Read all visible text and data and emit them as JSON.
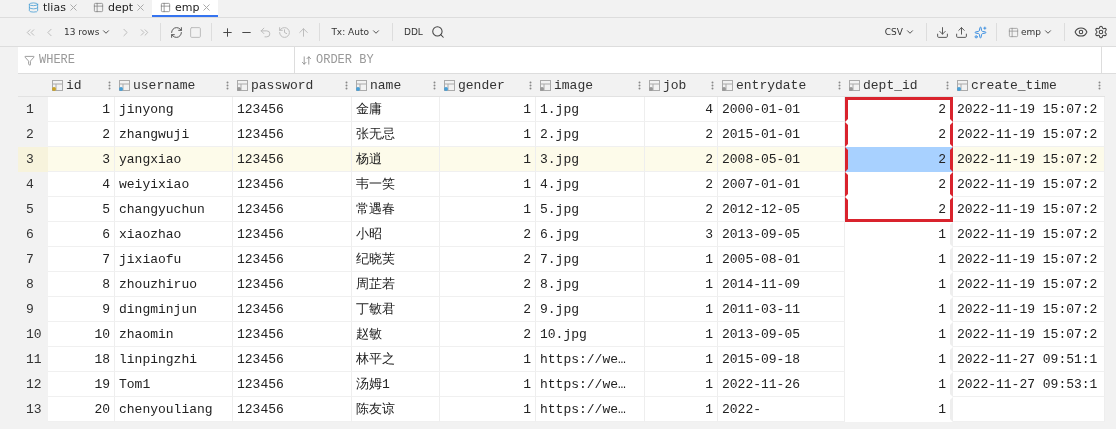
{
  "tabs": [
    {
      "label": "tlias",
      "kind": "schema",
      "selected": false
    },
    {
      "label": "dept",
      "kind": "table",
      "selected": false
    },
    {
      "label": "emp",
      "kind": "table",
      "selected": true
    }
  ],
  "toolbar": {
    "rows": "13 rows",
    "tx": "Tx: Auto",
    "ddl": "DDL",
    "export": "CSV",
    "schema": "emp"
  },
  "filter": {
    "where": "WHERE",
    "order": "ORDER BY"
  },
  "columns": [
    {
      "name": "id",
      "kind": "key"
    },
    {
      "name": "username",
      "kind": "index"
    },
    {
      "name": "password",
      "kind": "plain"
    },
    {
      "name": "name",
      "kind": "index"
    },
    {
      "name": "gender",
      "kind": "index"
    },
    {
      "name": "image",
      "kind": "plain"
    },
    {
      "name": "job",
      "kind": "plain"
    },
    {
      "name": "entrydate",
      "kind": "plain"
    },
    {
      "name": "dept_id",
      "kind": "plain"
    },
    {
      "name": "create_time",
      "kind": "index"
    }
  ],
  "rows": [
    {
      "number": "1",
      "current": false,
      "cells": [
        "1",
        "jinyong",
        "123456",
        "金庸",
        "1",
        "1.jpg",
        "4",
        "2000-01-01",
        {
          "text": "2",
          "selected": false,
          "framed": true
        },
        "2022-11-19 15:07:2"
      ]
    },
    {
      "number": "2",
      "current": false,
      "cells": [
        "2",
        "zhangwuji",
        "123456",
        "张无忌",
        "1",
        "2.jpg",
        "2",
        "2015-01-01",
        {
          "text": "2",
          "selected": false,
          "framed": true
        },
        "2022-11-19 15:07:2"
      ]
    },
    {
      "number": "3",
      "current": true,
      "cells": [
        "3",
        "yangxiao",
        "123456",
        "杨逍",
        "1",
        "3.jpg",
        "2",
        "2008-05-01",
        {
          "text": "2",
          "selected": true,
          "framed": true
        },
        "2022-11-19 15:07:2"
      ]
    },
    {
      "number": "4",
      "current": false,
      "cells": [
        "4",
        "weiyixiao",
        "123456",
        "韦一笑",
        "1",
        "4.jpg",
        "2",
        "2007-01-01",
        {
          "text": "2",
          "selected": false,
          "framed": true
        },
        "2022-11-19 15:07:2"
      ]
    },
    {
      "number": "5",
      "current": false,
      "cells": [
        "5",
        "changyuchun",
        "123456",
        "常遇春",
        "1",
        "5.jpg",
        "2",
        "2012-12-05",
        {
          "text": "2",
          "selected": false,
          "framed": true
        },
        "2022-11-19 15:07:2"
      ]
    },
    {
      "number": "6",
      "current": false,
      "cells": [
        "6",
        "xiaozhao",
        "123456",
        "小昭",
        "2",
        "6.jpg",
        "3",
        "2013-09-05",
        {
          "text": "1",
          "selected": false,
          "framed": false
        },
        "2022-11-19 15:07:2"
      ]
    },
    {
      "number": "7",
      "current": false,
      "cells": [
        "7",
        "jixiaofu",
        "123456",
        "纪晓芙",
        "2",
        "7.jpg",
        "1",
        "2005-08-01",
        {
          "text": "1",
          "selected": false,
          "framed": false
        },
        "2022-11-19 15:07:2"
      ]
    },
    {
      "number": "8",
      "current": false,
      "cells": [
        "8",
        "zhouzhiruo",
        "123456",
        "周芷若",
        "2",
        "8.jpg",
        "1",
        "2014-11-09",
        {
          "text": "1",
          "selected": false,
          "framed": false
        },
        "2022-11-19 15:07:2"
      ]
    },
    {
      "number": "9",
      "current": false,
      "cells": [
        "9",
        "dingminjun",
        "123456",
        "丁敏君",
        "2",
        "9.jpg",
        "1",
        "2011-03-11",
        {
          "text": "1",
          "selected": false,
          "framed": false
        },
        "2022-11-19 15:07:2"
      ]
    },
    {
      "number": "10",
      "current": false,
      "cells": [
        "10",
        "zhaomin",
        "123456",
        "赵敏",
        "2",
        "10.jpg",
        "1",
        "2013-09-05",
        {
          "text": "1",
          "selected": false,
          "framed": false
        },
        "2022-11-19 15:07:2"
      ]
    },
    {
      "number": "11",
      "current": false,
      "cells": [
        "18",
        "linpingzhi",
        "123456",
        "林平之",
        "1",
        "https://we…",
        "1",
        "2015-09-18",
        {
          "text": "1",
          "selected": false,
          "framed": false
        },
        "2022-11-27 09:51:1"
      ]
    },
    {
      "number": "12",
      "current": false,
      "cells": [
        "19",
        "Tom1",
        "123456",
        "汤姆1",
        "1",
        "https://we…",
        "1",
        "2022-11-26",
        {
          "text": "1",
          "selected": false,
          "framed": false
        },
        "2022-11-27 09:53:1"
      ]
    },
    {
      "number": "13",
      "current": false,
      "cells": [
        "20",
        "chenyouliang",
        "123456",
        "陈友谅",
        "1",
        "https://we…",
        "1",
        "2022-",
        {
          "text": "1",
          "selected": false,
          "framed": false
        }
      ]
    }
  ]
}
